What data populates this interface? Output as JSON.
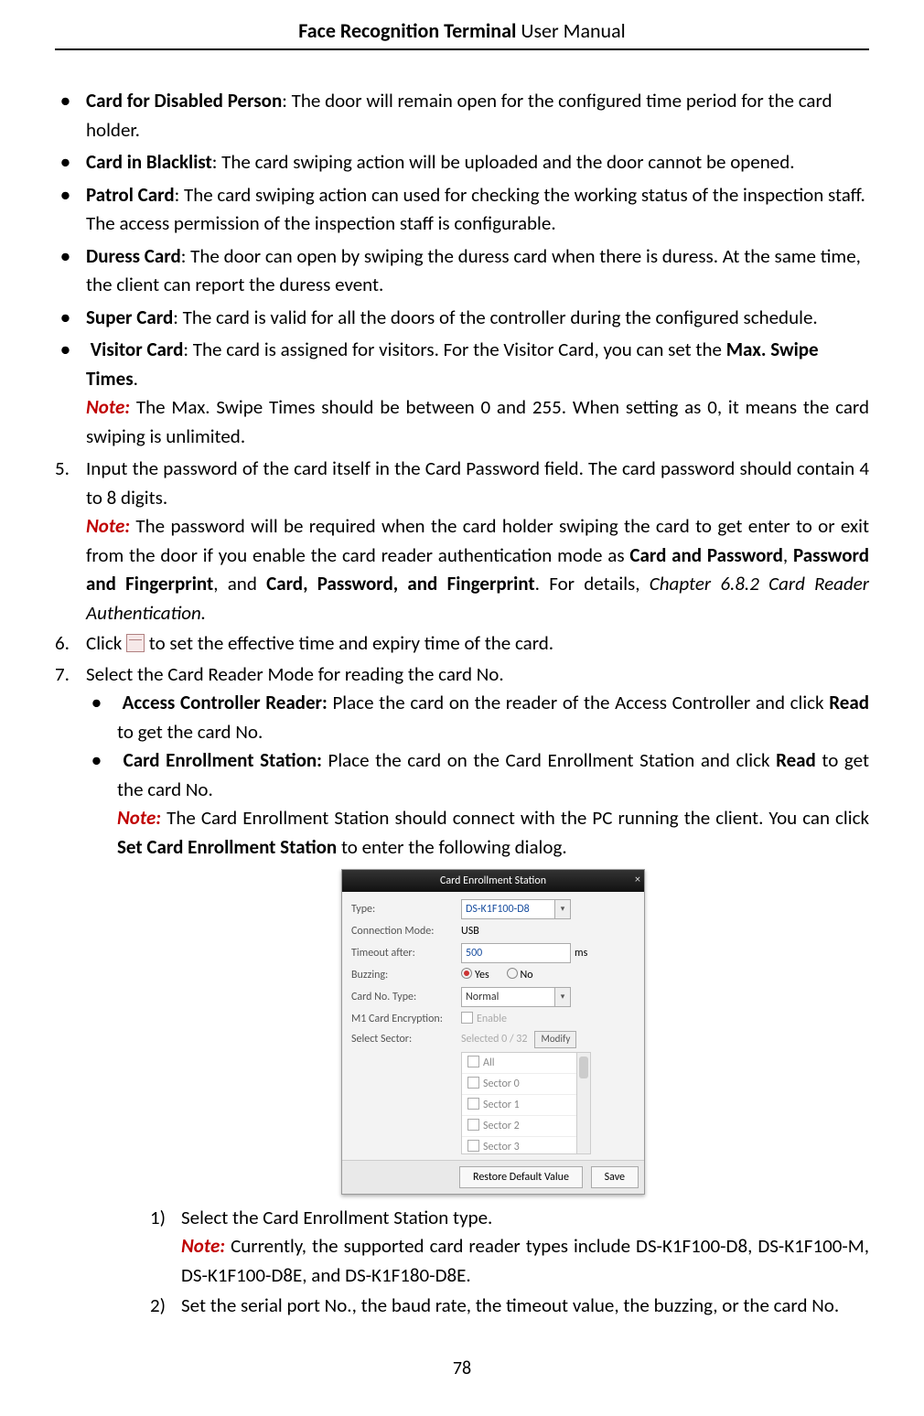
{
  "header": {
    "title_bold": "Face Recognition Terminal",
    "title_rest": "  User Manual"
  },
  "bullets_top": [
    {
      "term": "Card for Disabled Person",
      "text": ": The door will remain open for the configured time period for the card holder."
    },
    {
      "term": "Card in Blacklist",
      "text": ": The card swiping action will be uploaded and the door cannot be opened."
    },
    {
      "term": "Patrol Card",
      "text": ": The card swiping action can used for checking the working status of the inspection staff. The access permission of the inspection staff is configurable."
    },
    {
      "term": "Duress Card",
      "text": ": The door can open by swiping the duress card when there is duress. At the same time, the client can report the duress event."
    },
    {
      "term": "Super Card",
      "text": ": The card is valid for all the doors of the controller during the configured schedule."
    }
  ],
  "visitor": {
    "term": "Visitor Card",
    "text1": ": The card is assigned for visitors. For the Visitor Card, you can set the ",
    "bold_tail": "Max. Swipe Times",
    "period": ".",
    "note_label": "Note:",
    "note_text": " The Max. Swipe Times should be between 0 and 255. When setting as 0, it means the card swiping is unlimited."
  },
  "step5": {
    "num": "5.",
    "text": "Input the password of the card itself in the Card Password field. The card password should contain 4 to 8 digits.",
    "note_label": "Note:",
    "note_a": " The password will be required when the card holder swiping the card to get enter to or exit from the door if you enable the card reader authentication mode as ",
    "b1": "Card and Password",
    "sep1": ", ",
    "b2": "Password and Fingerprint",
    "sep2": ", and ",
    "b3": "Card, Password, and Fingerprint",
    "sep3": ". For details, ",
    "i1": "Chapter 6.8.2 Card Reader Authentication."
  },
  "step6": {
    "num": "6.",
    "pre": "Click ",
    "post": " to set the effective time and expiry time of the card."
  },
  "step7": {
    "num": "7.",
    "text": "Select the Card Reader Mode for reading the card No."
  },
  "sub": [
    {
      "term": "Access Controller Reader:",
      "a": " Place the card on the reader of the Access Controller and click ",
      "b": "Read",
      "c": " to get the card No."
    },
    {
      "term": "Card Enrollment Station:",
      "a": " Place the card on the Card Enrollment Station and click ",
      "b": "Read",
      "c": " to get the card No."
    }
  ],
  "ces_note": {
    "label": "Note:",
    "a": " The Card Enrollment Station should connect with the PC running the client. You can click ",
    "b": "Set Card Enrollment Station",
    "c": " to enter the following dialog."
  },
  "dialog": {
    "title": "Card Enrollment Station",
    "type_label": "Type:",
    "type_value": "DS-K1F100-D8",
    "conn_label": "Connection Mode:",
    "conn_value": "USB",
    "timeout_label": "Timeout after:",
    "timeout_value": "500",
    "timeout_unit": "ms",
    "buzz_label": "Buzzing:",
    "buzz_yes": "Yes",
    "buzz_no": "No",
    "cardno_label": "Card No. Type:",
    "cardno_value": "Normal",
    "m1_label": "M1 Card Encryption:",
    "m1_enable": "Enable",
    "sel_label": "Select Sector:",
    "sel_value": "Selected 0 / 32",
    "modify": "Modify",
    "sectors": [
      "All",
      "Sector 0",
      "Sector 1",
      "Sector 2",
      "Sector 3"
    ],
    "restore": "Restore Default Value",
    "save": "Save"
  },
  "sublist": [
    {
      "num": "1)",
      "text": "Select the Card Enrollment Station type.",
      "note_label": "Note:",
      "note_text": " Currently, the supported card reader types include DS-K1F100-D8, DS-K1F100-M, DS-K1F100-D8E, and DS-K1F180-D8E."
    },
    {
      "num": "2)",
      "text": "Set the serial port No., the baud rate, the timeout value, the buzzing, or the card No."
    }
  ],
  "page_num": "78"
}
